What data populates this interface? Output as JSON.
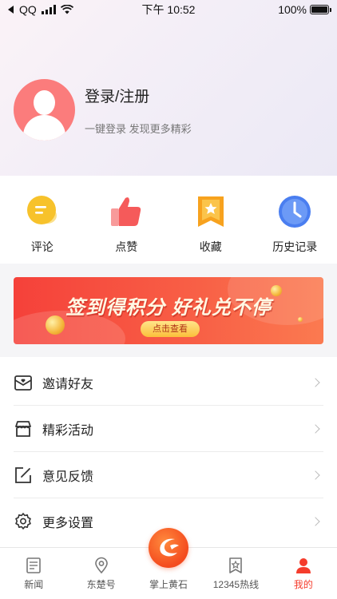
{
  "status_bar": {
    "carrier": "QQ",
    "time": "下午 10:52",
    "battery": "100%",
    "battery_level": 1.0
  },
  "profile": {
    "login_label": "登录/注册",
    "subtitle": "一键登录 发现更多精彩"
  },
  "quick_actions": [
    {
      "label": "评论",
      "icon": "comment-icon",
      "color": "#f7c22b"
    },
    {
      "label": "点赞",
      "icon": "thumbs-up-icon",
      "color": "#f55a5a"
    },
    {
      "label": "收藏",
      "icon": "bookmark-icon",
      "color": "#f7a21e"
    },
    {
      "label": "历史记录",
      "icon": "clock-icon",
      "color": "#4a7ef0"
    }
  ],
  "banner": {
    "title": "签到得积分 好礼兑不停",
    "button_label": "点击查看"
  },
  "menu": [
    {
      "label": "邀请好友",
      "icon": "invite-icon"
    },
    {
      "label": "精彩活动",
      "icon": "store-icon"
    },
    {
      "label": "意见反馈",
      "icon": "feedback-icon"
    },
    {
      "label": "更多设置",
      "icon": "settings-icon"
    }
  ],
  "tabbar": [
    {
      "label": "新闻",
      "icon": "news-icon",
      "active": false
    },
    {
      "label": "东楚号",
      "icon": "location-icon",
      "active": false
    },
    {
      "label": "掌上黄石",
      "icon": "app-logo-icon",
      "active": false
    },
    {
      "label": "12345热线",
      "icon": "hotline-icon",
      "active": false
    },
    {
      "label": "我的",
      "icon": "profile-icon",
      "active": true
    }
  ],
  "colors": {
    "accent": "#f53c2c",
    "avatar": "#fb7c7c"
  }
}
